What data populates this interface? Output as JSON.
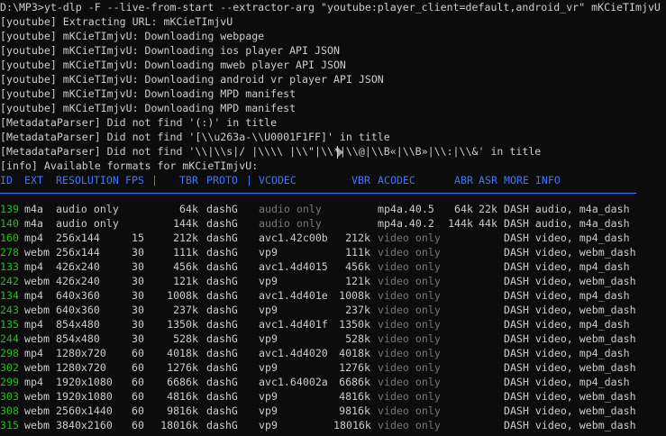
{
  "command": "D:\\MP3>yt-dlp -F --live-from-start --extractor-arg \"youtube:player_client=default,android_vr\" mKCieTImjvU",
  "log": [
    "[youtube] Extracting URL: mKCieTImjvU",
    "[youtube] mKCieTImjvU: Downloading webpage",
    "[youtube] mKCieTImjvU: Downloading ios player API JSON",
    "[youtube] mKCieTImjvU: Downloading mweb player API JSON",
    "[youtube] mKCieTImjvU: Downloading android vr player API JSON",
    "[youtube] mKCieTImjvU: Downloading MPD manifest",
    "[youtube] mKCieTImjvU: Downloading MPD manifest",
    "[MetadataParser] Did not find '(:)' in title",
    "[MetadataParser] Did not find '[\\\\u263a-\\\\U0001F1FF]' in title",
    "[MetadataParser] Did not find '\\\\|\\\\s|/ |\\\\\\\\ |\\\\\"|\\\\*|\\\\@|\\\\B«|\\\\B»|\\\\:|\\\\&' in title",
    "[info] Available formats for mKCieTImjvU:"
  ],
  "header": {
    "id": "ID",
    "ext": "EXT",
    "resolution": "RESOLUTION",
    "fps": "FPS",
    "sep": "|",
    "tbr": "TBR",
    "proto": "PROTO",
    "vcodec": "VCODEC",
    "vbr": "VBR",
    "acodec": "ACODEC",
    "abr": "ABR",
    "asr": "ASR",
    "more_info": "MORE INFO"
  },
  "formats": [
    {
      "id": "139",
      "ext": "m4a",
      "resolution": "audio only",
      "fps": "",
      "tbr": "64k",
      "proto": "dashG",
      "vcodec": "audio only",
      "vbr": "",
      "acodec": "mp4a.40.5",
      "abr": "64k",
      "asr": "22k",
      "more": "DASH audio, m4a_dash"
    },
    {
      "id": "140",
      "ext": "m4a",
      "resolution": "audio only",
      "fps": "",
      "tbr": "144k",
      "proto": "dashG",
      "vcodec": "audio only",
      "vbr": "",
      "acodec": "mp4a.40.2",
      "abr": "144k",
      "asr": "44k",
      "more": "DASH audio, m4a_dash"
    },
    {
      "id": "160",
      "ext": "mp4",
      "resolution": "256x144",
      "fps": "15",
      "tbr": "212k",
      "proto": "dashG",
      "vcodec": "avc1.42c00b",
      "vbr": "212k",
      "acodec": "video only",
      "abr": "",
      "asr": "",
      "more": "DASH video, mp4_dash"
    },
    {
      "id": "278",
      "ext": "webm",
      "resolution": "256x144",
      "fps": "30",
      "tbr": "111k",
      "proto": "dashG",
      "vcodec": "vp9",
      "vbr": "111k",
      "acodec": "video only",
      "abr": "",
      "asr": "",
      "more": "DASH video, webm_dash"
    },
    {
      "id": "133",
      "ext": "mp4",
      "resolution": "426x240",
      "fps": "30",
      "tbr": "456k",
      "proto": "dashG",
      "vcodec": "avc1.4d4015",
      "vbr": "456k",
      "acodec": "video only",
      "abr": "",
      "asr": "",
      "more": "DASH video, mp4_dash"
    },
    {
      "id": "242",
      "ext": "webm",
      "resolution": "426x240",
      "fps": "30",
      "tbr": "121k",
      "proto": "dashG",
      "vcodec": "vp9",
      "vbr": "121k",
      "acodec": "video only",
      "abr": "",
      "asr": "",
      "more": "DASH video, webm_dash"
    },
    {
      "id": "134",
      "ext": "mp4",
      "resolution": "640x360",
      "fps": "30",
      "tbr": "1008k",
      "proto": "dashG",
      "vcodec": "avc1.4d401e",
      "vbr": "1008k",
      "acodec": "video only",
      "abr": "",
      "asr": "",
      "more": "DASH video, mp4_dash"
    },
    {
      "id": "243",
      "ext": "webm",
      "resolution": "640x360",
      "fps": "30",
      "tbr": "237k",
      "proto": "dashG",
      "vcodec": "vp9",
      "vbr": "237k",
      "acodec": "video only",
      "abr": "",
      "asr": "",
      "more": "DASH video, webm_dash"
    },
    {
      "id": "135",
      "ext": "mp4",
      "resolution": "854x480",
      "fps": "30",
      "tbr": "1350k",
      "proto": "dashG",
      "vcodec": "avc1.4d401f",
      "vbr": "1350k",
      "acodec": "video only",
      "abr": "",
      "asr": "",
      "more": "DASH video, mp4_dash"
    },
    {
      "id": "244",
      "ext": "webm",
      "resolution": "854x480",
      "fps": "30",
      "tbr": "528k",
      "proto": "dashG",
      "vcodec": "vp9",
      "vbr": "528k",
      "acodec": "video only",
      "abr": "",
      "asr": "",
      "more": "DASH video, webm_dash"
    },
    {
      "id": "298",
      "ext": "mp4",
      "resolution": "1280x720",
      "fps": "60",
      "tbr": "4018k",
      "proto": "dashG",
      "vcodec": "avc1.4d4020",
      "vbr": "4018k",
      "acodec": "video only",
      "abr": "",
      "asr": "",
      "more": "DASH video, mp4_dash"
    },
    {
      "id": "302",
      "ext": "webm",
      "resolution": "1280x720",
      "fps": "60",
      "tbr": "1276k",
      "proto": "dashG",
      "vcodec": "vp9",
      "vbr": "1276k",
      "acodec": "video only",
      "abr": "",
      "asr": "",
      "more": "DASH video, webm_dash"
    },
    {
      "id": "299",
      "ext": "mp4",
      "resolution": "1920x1080",
      "fps": "60",
      "tbr": "6686k",
      "proto": "dashG",
      "vcodec": "avc1.64002a",
      "vbr": "6686k",
      "acodec": "video only",
      "abr": "",
      "asr": "",
      "more": "DASH video, mp4_dash"
    },
    {
      "id": "303",
      "ext": "webm",
      "resolution": "1920x1080",
      "fps": "60",
      "tbr": "4816k",
      "proto": "dashG",
      "vcodec": "vp9",
      "vbr": "4816k",
      "acodec": "video only",
      "abr": "",
      "asr": "",
      "more": "DASH video, webm_dash"
    },
    {
      "id": "308",
      "ext": "webm",
      "resolution": "2560x1440",
      "fps": "60",
      "tbr": "9816k",
      "proto": "dashG",
      "vcodec": "vp9",
      "vbr": "9816k",
      "acodec": "video only",
      "abr": "",
      "asr": "",
      "more": "DASH video, webm_dash"
    },
    {
      "id": "315",
      "ext": "webm",
      "resolution": "3840x2160",
      "fps": "60",
      "tbr": "18016k",
      "proto": "dashG",
      "vcodec": "vp9",
      "vbr": "18016k",
      "acodec": "video only",
      "abr": "",
      "asr": "",
      "more": "DASH video, webm_dash"
    }
  ],
  "colors": {
    "background": "#0c0c0c",
    "text": "#cccccc",
    "header": "#3b78ff",
    "format_id": "#16c60c",
    "dim": "#767676"
  }
}
